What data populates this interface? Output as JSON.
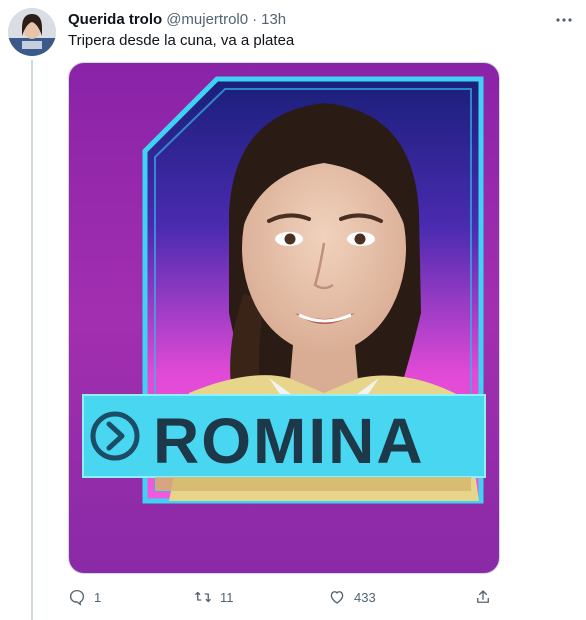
{
  "tweet": {
    "display_name": "Querida trolo",
    "handle": "@mujertrol0",
    "separator": "·",
    "time": "13h",
    "text": "Tripera desde la cuna, va a platea"
  },
  "media": {
    "name_label": "ROMINA",
    "background_color": "#a22fb0",
    "frame_color": "#3fd3f3",
    "label_color": "#49d6f0"
  },
  "actions": {
    "reply_count": "1",
    "retweet_count": "11",
    "like_count": "433"
  },
  "icons": [
    "more-icon",
    "reply-icon",
    "retweet-icon",
    "like-icon",
    "share-icon"
  ]
}
